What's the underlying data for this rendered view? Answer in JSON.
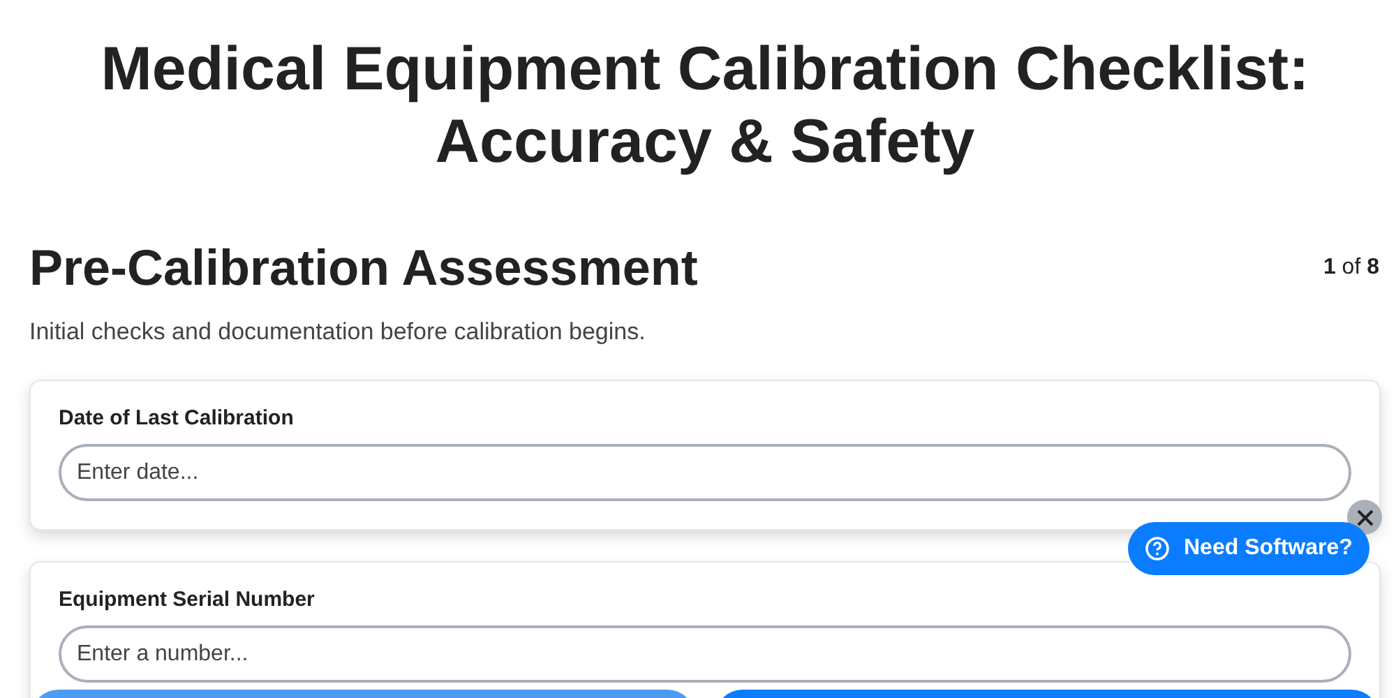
{
  "title": "Medical Equipment Calibration Checklist: Accuracy & Safety",
  "section": {
    "heading": "Pre-Calibration Assessment",
    "counter": "**1** of **8**",
    "description": "Initial checks and documentation before calibration begins."
  },
  "fields": [
    {
      "label": "Date of Last Calibration",
      "placeholder": "Enter date..."
    },
    {
      "label": "Equipment Serial Number",
      "placeholder": "Enter a number..."
    }
  ],
  "help_button": {
    "label": "Need Software?"
  },
  "nav_buttons": [
    {
      "kind": "secondary"
    },
    {
      "kind": "primary"
    }
  ]
}
